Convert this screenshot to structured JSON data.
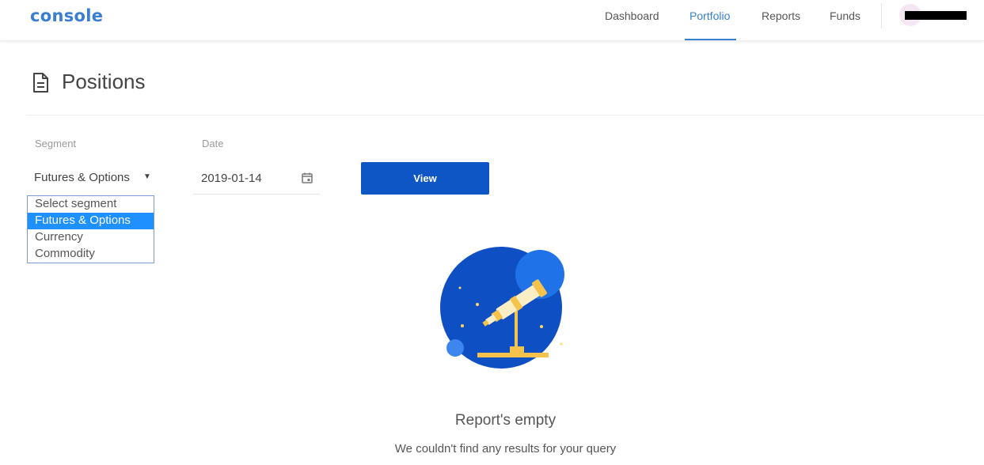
{
  "header": {
    "logo": "console",
    "nav": [
      {
        "label": "Dashboard",
        "active": false
      },
      {
        "label": "Portfolio",
        "active": true
      },
      {
        "label": "Reports",
        "active": false
      },
      {
        "label": "Funds",
        "active": false
      }
    ],
    "accent_color": "#387ed1"
  },
  "page": {
    "title": "Positions",
    "icon": "document-icon"
  },
  "filters": {
    "segment_label": "Segment",
    "segment_value": "Futures & Options",
    "segment_options": [
      "Select segment",
      "Futures & Options",
      "Currency",
      "Commodity"
    ],
    "selected_option_index": 1,
    "date_label": "Date",
    "date_value": "2019-01-14",
    "view_button": "View",
    "button_color": "#0e56c6"
  },
  "empty_state": {
    "title": "Report's empty",
    "message": "We couldn't find any results for your query",
    "illustration": "telescope-illustration"
  }
}
